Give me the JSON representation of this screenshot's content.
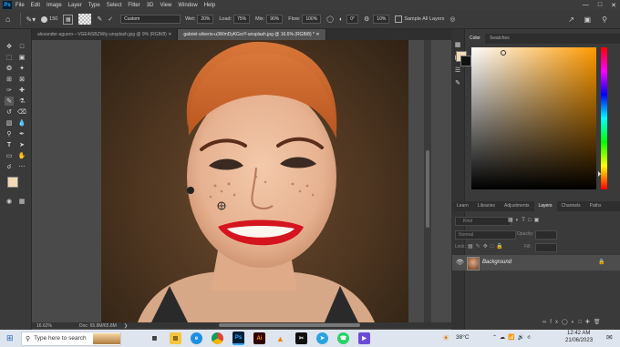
{
  "menubar": {
    "app_logo": "Ps",
    "items": [
      "File",
      "Edit",
      "Image",
      "Layer",
      "Type",
      "Select",
      "Filter",
      "3D",
      "View",
      "Window",
      "Help"
    ]
  },
  "options": {
    "brush_size": "150",
    "source": "Custom",
    "wet_label": "Wet:",
    "wet_value": "20%",
    "load_label": "Load:",
    "load_value": "75%",
    "mix_label": "Mix:",
    "mix_value": "90%",
    "flow_label": "Flow:",
    "flow_value": "100%",
    "angle_value": "0°",
    "smoothing_value": "10%",
    "sample_label": "Sample All Layers"
  },
  "tabs": [
    {
      "label": "alexander-aguero---VGE4tSBZWty-unsplash.jpg @ 9% (RGB/8)",
      "active": false
    },
    {
      "label": "gabriel-silverio-u3WmDyKGsrY-unsplash.jpg @ 16.6% (RGB/8) *",
      "active": true
    }
  ],
  "status": {
    "zoom": "16.62%",
    "doc": "Doc: 65.8M/65.8M"
  },
  "color_panel": {
    "tabs": [
      "Color",
      "Swatches"
    ],
    "fg_color": "#f3d9b4",
    "bg_color": "#111111"
  },
  "layers_panel": {
    "tabs": [
      "Learn",
      "Libraries",
      "Adjustments",
      "Layers",
      "Channels",
      "Paths"
    ],
    "active_tab": "Layers",
    "filter_placeholder": "Kind",
    "blend_mode": "Normal",
    "opacity_label": "Opacity:",
    "fill_label": "Fill:",
    "lock_label": "Lock:",
    "layer_name": "Background"
  },
  "taskbar": {
    "search_placeholder": "Type here to search",
    "weather": "38°C",
    "time": "12:42 AM",
    "date": "21/06/2023",
    "apps": [
      "file-explorer",
      "edge",
      "chrome",
      "photoshop",
      "illustrator",
      "vlc",
      "capcut",
      "telegram",
      "whatsapp",
      "media"
    ]
  }
}
